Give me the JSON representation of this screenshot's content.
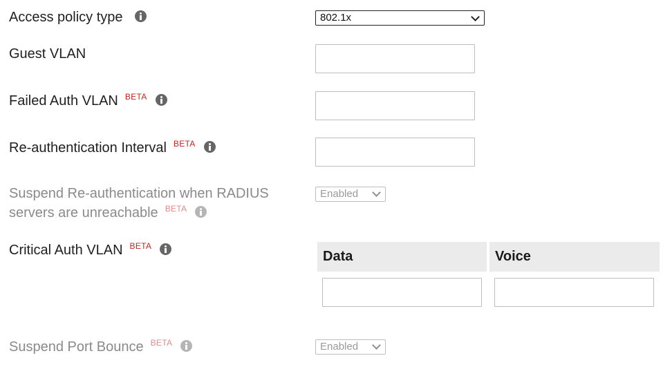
{
  "fields": {
    "access_policy_type": {
      "label": "Access policy type",
      "value": "802.1x"
    },
    "guest_vlan": {
      "label": "Guest VLAN",
      "value": ""
    },
    "failed_auth_vlan": {
      "label": "Failed Auth VLAN",
      "badge": "BETA",
      "value": ""
    },
    "reauth_interval": {
      "label": "Re-authentication Interval",
      "badge": "BETA",
      "value": ""
    },
    "suspend_reauth": {
      "label_line1": "Suspend Re-authentication when RADIUS",
      "label_line2": "servers are unreachable",
      "badge": "BETA",
      "value": "Enabled"
    },
    "critical_auth_vlan": {
      "label": "Critical Auth VLAN",
      "badge": "BETA",
      "columns": [
        "Data",
        "Voice"
      ],
      "data_value": "",
      "voice_value": ""
    },
    "suspend_port_bounce": {
      "label": "Suspend Port Bounce",
      "badge": "BETA",
      "value": "Enabled"
    }
  },
  "colors": {
    "beta": "#cc1f1f",
    "disabled_text": "#8a8a8a",
    "table_header_bg": "#ebebeb",
    "info_icon": "#666666"
  },
  "icons": [
    "info-icon",
    "chevron-down-icon"
  ]
}
